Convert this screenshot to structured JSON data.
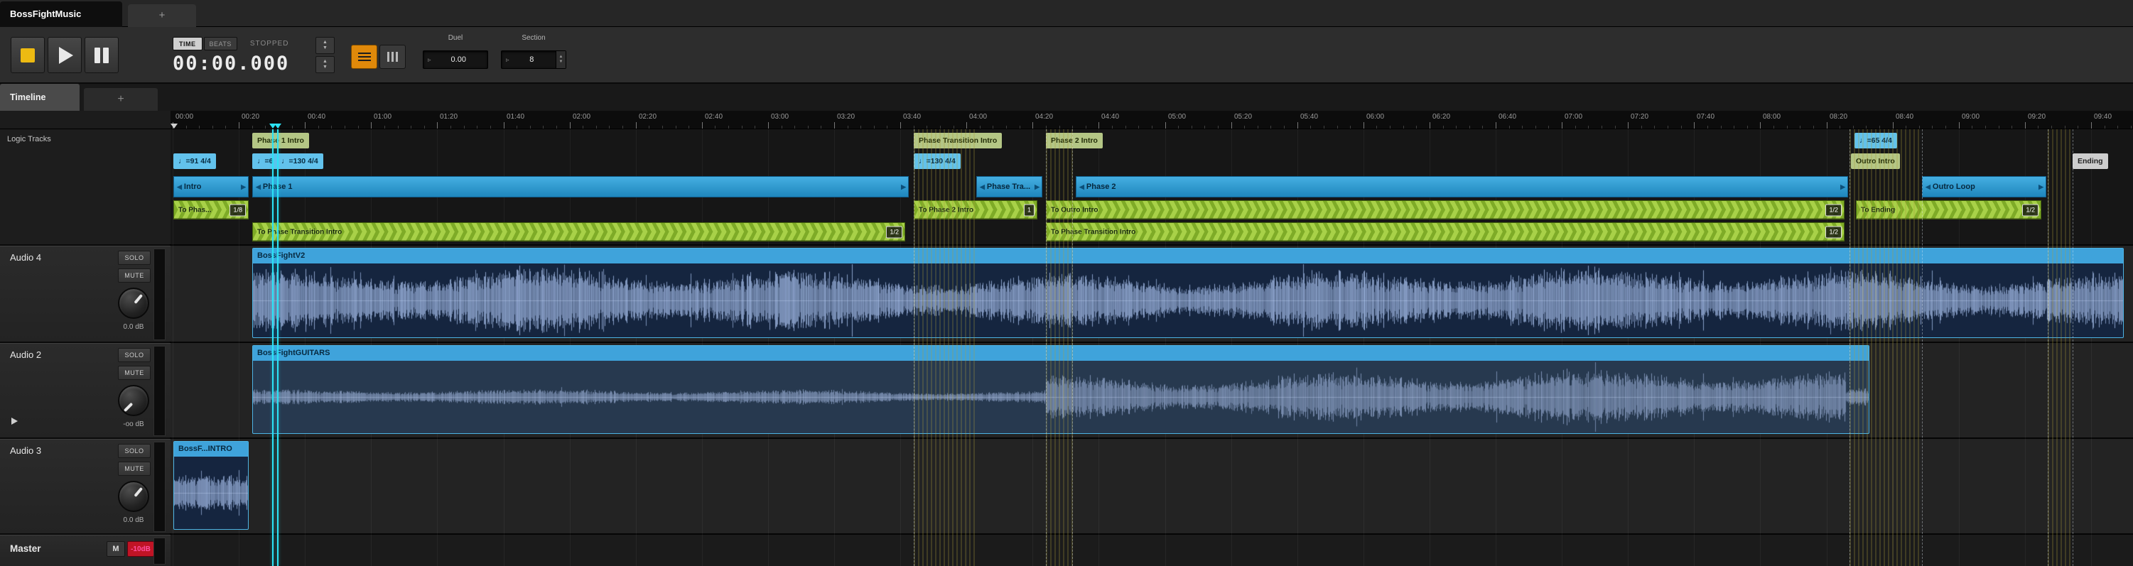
{
  "window": {
    "event_tab": "BossFightMusic",
    "new_tab_label": "+"
  },
  "transport": {
    "time_mode_label": "TIME",
    "beats_mode_label": "BEATS",
    "status": "STOPPED",
    "time_display": "00:00.000",
    "params": [
      {
        "label": "Duel",
        "value": "0.00"
      },
      {
        "label": "Section",
        "value": "8"
      }
    ]
  },
  "view_tabs": {
    "timeline": "Timeline",
    "new_tab_label": "+"
  },
  "left_panel": {
    "logic_tracks_label": "Logic Tracks"
  },
  "ruler_labels": [
    "00:00",
    "00:20",
    "00:40",
    "01:00",
    "01:20",
    "01:40",
    "02:00",
    "02:20",
    "02:40",
    "03:00",
    "03:20",
    "03:40",
    "04:00",
    "04:20",
    "04:40",
    "05:00",
    "05:20",
    "05:40",
    "06:00",
    "06:20",
    "06:40",
    "07:00",
    "07:20",
    "07:40",
    "08:00",
    "08:20",
    "08:40",
    "09:00",
    "09:20",
    "09:40"
  ],
  "logic_items": [
    {
      "kind": "marker",
      "label": "Phase 1 Intro",
      "row": 1,
      "t": 24
    },
    {
      "kind": "marker",
      "label": "Phase Transition Intro",
      "row": 1,
      "t": 224
    },
    {
      "kind": "marker",
      "label": "Phase 2 Intro",
      "row": 1,
      "t": 264
    },
    {
      "kind": "tempo",
      "label": "♩=65 4/4",
      "row": 1,
      "t": 508.5
    },
    {
      "kind": "tempo",
      "label": "♩=91 4/4",
      "row": 2,
      "t": 0.3
    },
    {
      "kind": "tempo",
      "label": "♩=6",
      "row": 2,
      "t": 24
    },
    {
      "kind": "tempo",
      "label": "♩=130 4/4",
      "row": 2,
      "t": 31.3
    },
    {
      "kind": "tempo",
      "label": "♩=130 4/4",
      "row": 2,
      "t": 224
    },
    {
      "kind": "marker",
      "label": "Outro Intro",
      "row": 2,
      "t": 507.5
    },
    {
      "kind": "end",
      "label": "Ending",
      "row": 2,
      "t": 574.5
    },
    {
      "kind": "section",
      "label": "Intro",
      "row": 3,
      "t": 0.3,
      "t1": 23
    },
    {
      "kind": "section",
      "label": "Phase 1",
      "row": 3,
      "t": 24,
      "t1": 222.5
    },
    {
      "kind": "section",
      "label": "Phase Tra...",
      "row": 3,
      "t": 243,
      "t1": 263
    },
    {
      "kind": "section",
      "label": "Phase 2",
      "row": 3,
      "t": 273,
      "t1": 506.5
    },
    {
      "kind": "section",
      "label": "Outro Loop",
      "row": 3,
      "t": 529,
      "t1": 566.5
    },
    {
      "kind": "transition",
      "label": "To Phas...",
      "badge": "1/8",
      "row": 4,
      "t": 0.3,
      "t1": 23
    },
    {
      "kind": "transition",
      "label": "To Phase 2 Intro",
      "badge": "1",
      "row": 4,
      "t": 224,
      "t1": 261.5
    },
    {
      "kind": "transition",
      "label": "To Outro Intro",
      "badge": "1/2",
      "row": 4,
      "t": 264,
      "t1": 505.5
    },
    {
      "kind": "transition",
      "label": "To Ending",
      "badge": "1/2",
      "row": 4,
      "t": 509,
      "t1": 565
    },
    {
      "kind": "transition",
      "label": "To Phase Transition Intro",
      "badge": "1/2",
      "row": 5,
      "t": 24,
      "t1": 221.5
    },
    {
      "kind": "transition",
      "label": "To Phase Transition Intro",
      "badge": "1/2",
      "row": 5,
      "t": 264,
      "t1": 505.5
    }
  ],
  "tracks": [
    {
      "type": "audio",
      "name": "Audio 4",
      "solo_label": "SOLO",
      "mute_label": "MUTE",
      "volume": "0.0 dB",
      "knob_deg": 40,
      "clips": [
        {
          "name": "BossFightV2",
          "t": 24,
          "t1": 590,
          "tone": "bright",
          "wave": [
            {
              "t": 24,
              "t1": 590,
              "amp": 0.82
            }
          ]
        }
      ]
    },
    {
      "type": "audio",
      "name": "Audio 2",
      "solo_label": "SOLO",
      "mute_label": "MUTE",
      "volume": "-oo dB",
      "knob_deg": -135,
      "disclosure": true,
      "clips": [
        {
          "name": "BossFightGUITARS",
          "t": 24,
          "t1": 513,
          "tone": "dim",
          "wave": [
            {
              "t": 24,
              "t1": 264,
              "amp": 0.2
            },
            {
              "t": 264,
              "t1": 506,
              "amp": 0.68
            },
            {
              "t": 506,
              "t1": 513,
              "amp": 0.22
            }
          ]
        }
      ]
    },
    {
      "type": "audio",
      "name": "Audio 3",
      "solo_label": "SOLO",
      "mute_label": "MUTE",
      "volume": "0.0 dB",
      "knob_deg": 40,
      "clips": [
        {
          "name": "BossF...INTRO",
          "t": 0.3,
          "t1": 23,
          "tone": "bright",
          "wave": [
            {
              "t": 0.3,
              "t1": 23,
              "amp": 0.5
            }
          ]
        }
      ]
    },
    {
      "type": "master",
      "name": "Master",
      "mute_label": "M",
      "meter_label": "-10dB",
      "clips": []
    }
  ],
  "overlays": {
    "playheads": [
      {
        "t": 30.2
      },
      {
        "t": 31.8
      }
    ],
    "dashed_lines": [
      {
        "t": 224
      },
      {
        "t": 264
      },
      {
        "t": 272
      },
      {
        "t": 507
      },
      {
        "t": 529
      },
      {
        "t": 567
      },
      {
        "t": 574.5
      }
    ],
    "striped_regions": [
      {
        "t": 224,
        "t1": 243
      },
      {
        "t": 264,
        "t1": 272.5
      },
      {
        "t": 507,
        "t1": 529
      },
      {
        "t": 567,
        "t1": 574.5
      }
    ]
  },
  "colors": {
    "section_blue_top": "#45AFE2",
    "section_blue_bottom": "#1F86BC",
    "section_border": "#0F5D8C",
    "green_light": "#A8D148",
    "green_dark": "#7EAB27",
    "green_border": "#46650D",
    "marker_khaki": "#B4C685",
    "tempo_blue": "#62C2EC",
    "ending_gray": "#CDCDCD",
    "clip_title": "#3FA3DB",
    "clip_border": "#4DB4E4",
    "clip_body_bright": "#15253F",
    "clip_body_dim": "#27394F",
    "wave_bright": "#8FA6CF",
    "wave_dim": "#7E92B5",
    "stop_yellow": "#EDBA12",
    "view_orange": "#E0890A",
    "master_red": "#C01425",
    "master_pink": "#FF4FA0",
    "playhead_cyan": "#2BE3F5"
  }
}
